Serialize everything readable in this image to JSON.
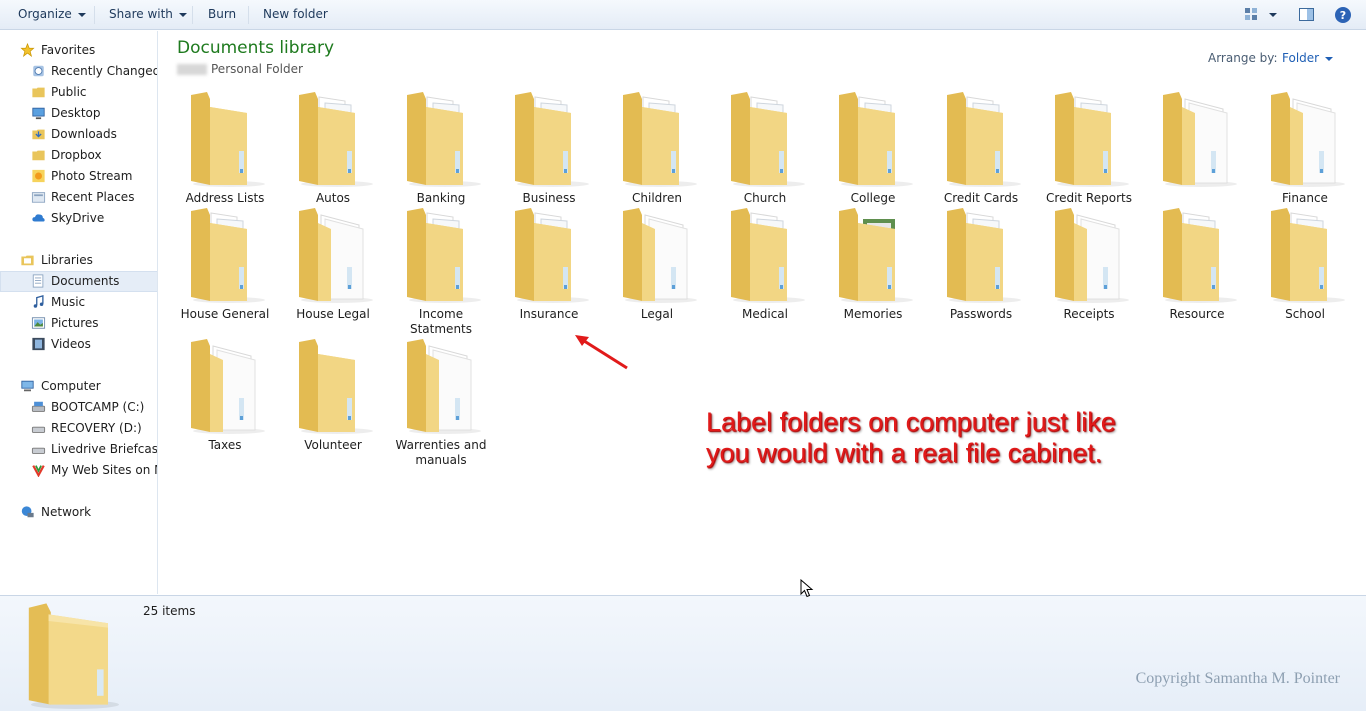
{
  "toolbar": {
    "organize": "Organize",
    "share_with": "Share with",
    "burn": "Burn",
    "new_folder": "New folder"
  },
  "nav": {
    "favorites": "Favorites",
    "recently_changed": "Recently Changed",
    "public": "Public",
    "desktop": "Desktop",
    "downloads": "Downloads",
    "dropbox": "Dropbox",
    "photo_stream": "Photo Stream",
    "recent_places": "Recent Places",
    "skydrive": "SkyDrive",
    "libraries": "Libraries",
    "documents": "Documents",
    "music": "Music",
    "pictures": "Pictures",
    "videos": "Videos",
    "computer": "Computer",
    "bootcamp": "BOOTCAMP (C:)",
    "recovery": "RECOVERY (D:)",
    "livedrive": "Livedrive Briefcase (I",
    "websites": "My Web Sites on MS",
    "network": "Network"
  },
  "library": {
    "title": "Documents library",
    "subtitle": "Personal Folder",
    "arrange_label": "Arrange by:",
    "arrange_value": "Folder"
  },
  "folders": [
    {
      "name": "Address Lists",
      "style": "plain"
    },
    {
      "name": "Autos",
      "style": "docs"
    },
    {
      "name": "Banking",
      "style": "docs"
    },
    {
      "name": "Business",
      "style": "docs"
    },
    {
      "name": "Children",
      "style": "docs"
    },
    {
      "name": "Church",
      "style": "docs"
    },
    {
      "name": "College",
      "style": "docs"
    },
    {
      "name": "Credit Cards",
      "style": "docs"
    },
    {
      "name": "Credit Reports",
      "style": "docs"
    },
    {
      "name": "",
      "style": "white"
    },
    {
      "name": "Finance",
      "style": "white"
    },
    {
      "name": "House General",
      "style": "docs"
    },
    {
      "name": "House Legal",
      "style": "white"
    },
    {
      "name": "Income Statments",
      "style": "docs"
    },
    {
      "name": "Insurance",
      "style": "docs"
    },
    {
      "name": "Legal",
      "style": "white"
    },
    {
      "name": "Medical",
      "style": "docs"
    },
    {
      "name": "Memories",
      "style": "photo"
    },
    {
      "name": "Passwords",
      "style": "docs"
    },
    {
      "name": "Receipts",
      "style": "white"
    },
    {
      "name": "Resource",
      "style": "docs"
    },
    {
      "name": "School",
      "style": "docs"
    },
    {
      "name": "Taxes",
      "style": "white"
    },
    {
      "name": "Volunteer",
      "style": "plain"
    },
    {
      "name": "Warrenties and manuals",
      "style": "white"
    }
  ],
  "annotation": "Label folders on computer just like you would with a real file cabinet.",
  "details": {
    "count": "25 items",
    "copyright": "Copyright Samantha M. Pointer"
  },
  "colors": {
    "folder_yellow": "#f3d87f",
    "library_title": "#1e7a1e",
    "annotation_red": "#e11a1a"
  }
}
